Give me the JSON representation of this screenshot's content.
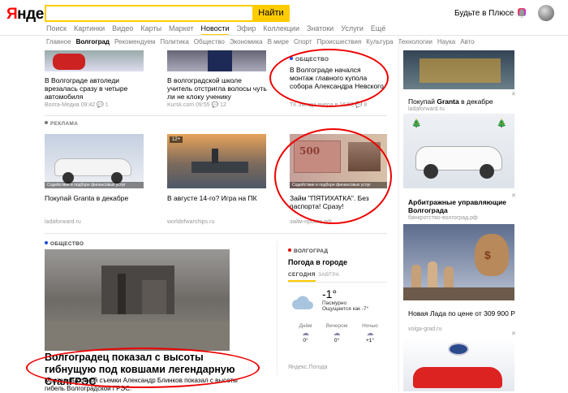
{
  "header": {
    "logo_first": "Я",
    "logo_rest": "ндекс",
    "search_button": "Найти",
    "plus_text": "Будьте в Плюсе"
  },
  "services": [
    "Поиск",
    "Картинки",
    "Видео",
    "Карты",
    "Маркет",
    "Новости",
    "Эфир",
    "Коллекции",
    "Знатоки",
    "Услуги",
    "Ещё"
  ],
  "categories": [
    "Главное",
    "Волгоград",
    "Рекомендуем",
    "Политика",
    "Общество",
    "Экономика",
    "В мире",
    "Спорт",
    "Происшествия",
    "Культура",
    "Технологии",
    "Наука",
    "Авто"
  ],
  "top_news": [
    {
      "text": "В Волгограде автоледи врезалась сразу в четыре автомобиля",
      "source": "Волга-Медиа 09:42",
      "comments": "1"
    },
    {
      "text": "В волгоградской школе учитель отстригла волосы чуть ли не клоку ученику",
      "source": "Kursk.com 09:55",
      "comments": "12"
    },
    {
      "tag": "ОБЩЕСТВО",
      "text": "В Волгограде начался монтаж главного купола собора Александра Невского",
      "source": "ТК Звезда вчера в 16:56",
      "comments": "8"
    }
  ],
  "ads_label": "РЕКЛАМА",
  "ads": [
    {
      "text": "Покупай Granta в декабре",
      "source": "ladaforward.ru",
      "disclaimer": "Содействие в подборе финансовых услуг"
    },
    {
      "text": "В августе 14-го? Игра на ПК",
      "source": "worldofwarships.ru",
      "badge": "12+"
    },
    {
      "text": "Займ \"ПЯТИХАТКА\". Без паспорта! Сразу!",
      "source": "займ-просто.рф",
      "disclaimer": "Содействие в подборе финансовых услуг"
    }
  ],
  "main_story": {
    "tag": "ОБЩЕСТВО",
    "title": "Волгоградец показал с высоты гибнущую под ковшами легендарную СталГРЭС",
    "desc": "Мастер высотной съемки Александр Блинков показал с высоты гибель Волгоградской ГРЭС."
  },
  "weather": {
    "tag": "ВОЛГОГРАД",
    "title": "Погода в городе",
    "tab_today": "СЕГОДНЯ",
    "tab_tomorrow": "ЗАВТРА",
    "temp": "-1°",
    "cond": "Пасмурно",
    "feels": "Ощущается как -7°",
    "parts": [
      {
        "label": "Днём",
        "t": "0°"
      },
      {
        "label": "Вечером",
        "t": "0°"
      },
      {
        "label": "Ночью",
        "t": "+1°"
      }
    ],
    "source": "Яндекс.Погода"
  },
  "right_ads": [
    {
      "title_pre": "Покупай ",
      "title_bold": "Granta",
      "title_post": " в декабре",
      "source": "ladaforward.ru"
    },
    {
      "title": "Арбитражные управляющие Волгограда",
      "source": "банкротство-волгоград.рф"
    },
    {
      "title": "Новая Лада по цене от 309 900 Р",
      "source": "volga-grad.ru"
    }
  ],
  "colors": {
    "accent": "#ffcc00",
    "annotation": "#e00000",
    "tag_blue": "#1a4dd8",
    "tag_red": "#e00000"
  }
}
